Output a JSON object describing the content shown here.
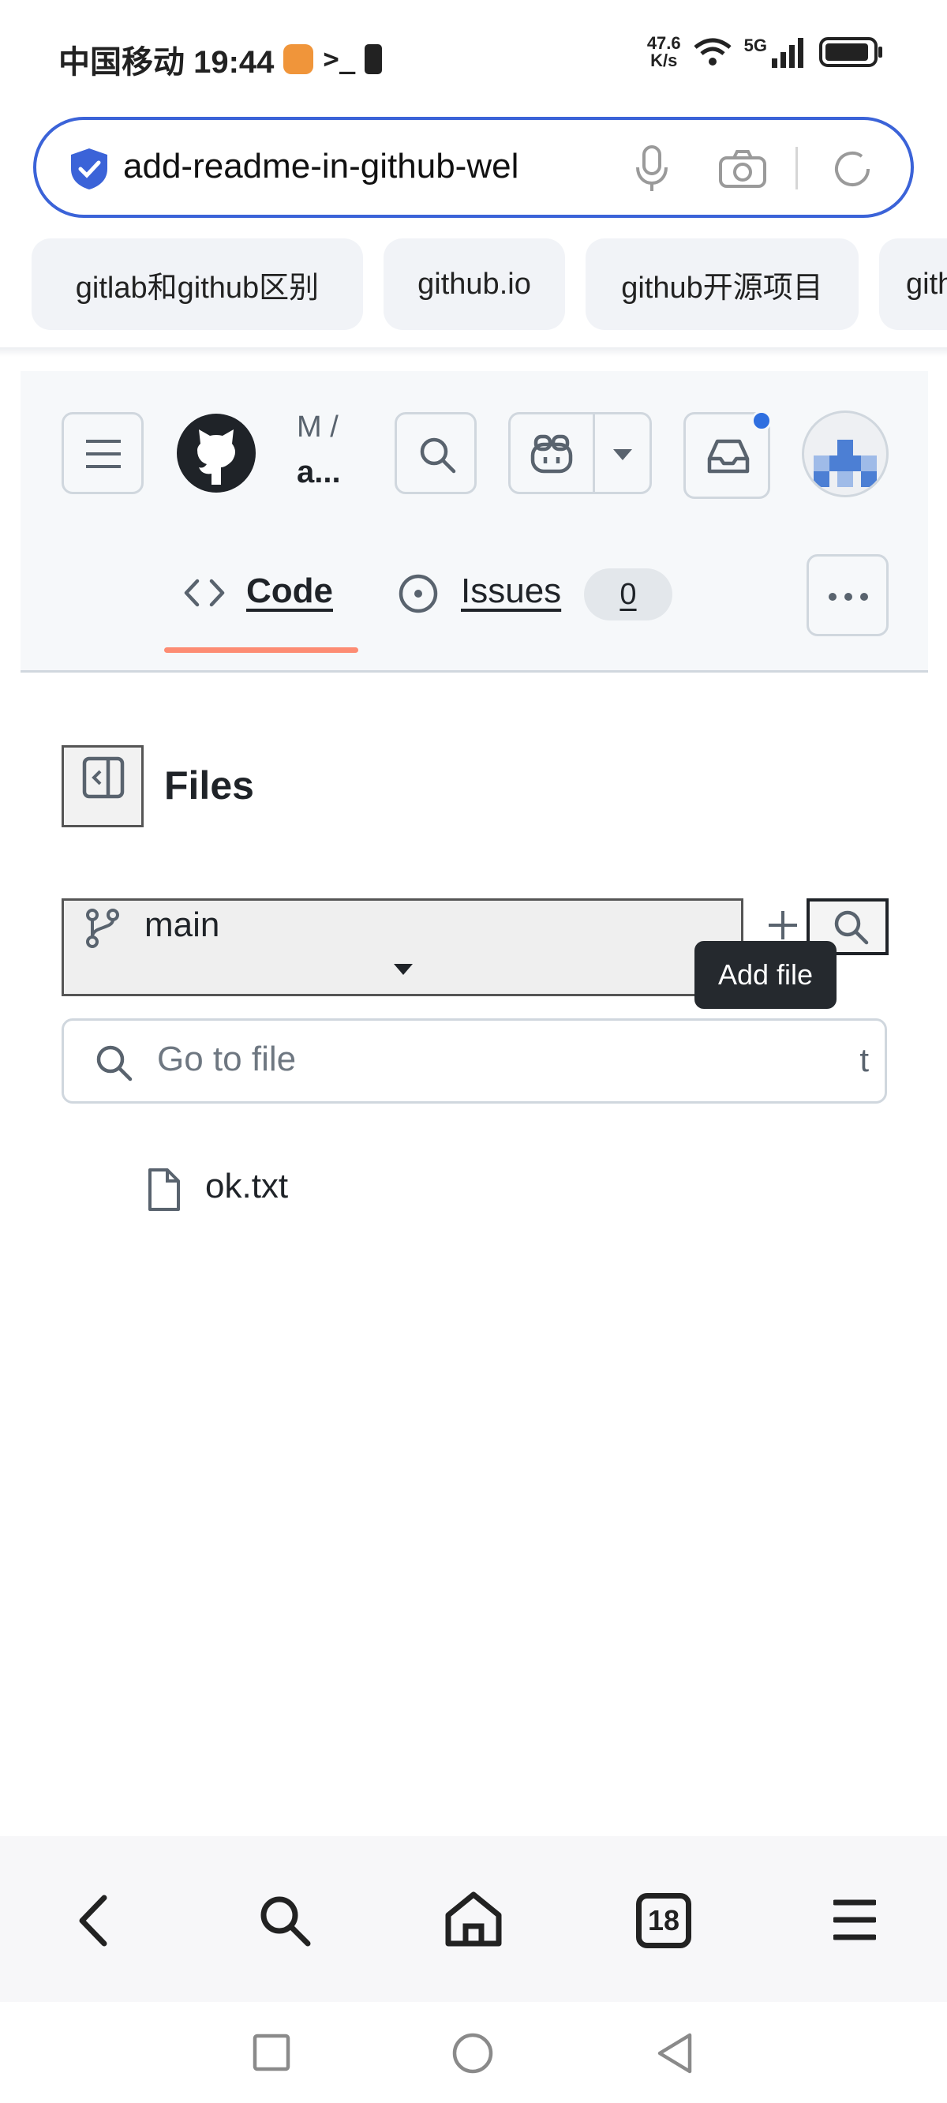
{
  "status": {
    "carrier_time": "中国移动 19:44",
    "speed_top": "47.6",
    "speed_bottom": "K/s",
    "network": "5G"
  },
  "browser": {
    "url": "add-readme-in-github-wel",
    "chips": [
      "gitlab和github区别",
      "github.io",
      "github开源项目",
      "gith"
    ]
  },
  "repo": {
    "owner": "M /",
    "name": "a...",
    "tabs": [
      {
        "label": "Code"
      },
      {
        "label": "Issues",
        "count": "0"
      }
    ]
  },
  "files": {
    "title": "Files",
    "branch": "main",
    "tooltip": "Add file",
    "goto_placeholder": "Go to file",
    "goto_shortcut": "t",
    "items": [
      {
        "name": "ok.txt"
      }
    ]
  },
  "bottom": {
    "tabs_count": "18"
  },
  "colors": {
    "accent_blue": "#3b63d8",
    "tab_underline": "#fd8c73",
    "notification_dot": "#2f6fe0"
  }
}
